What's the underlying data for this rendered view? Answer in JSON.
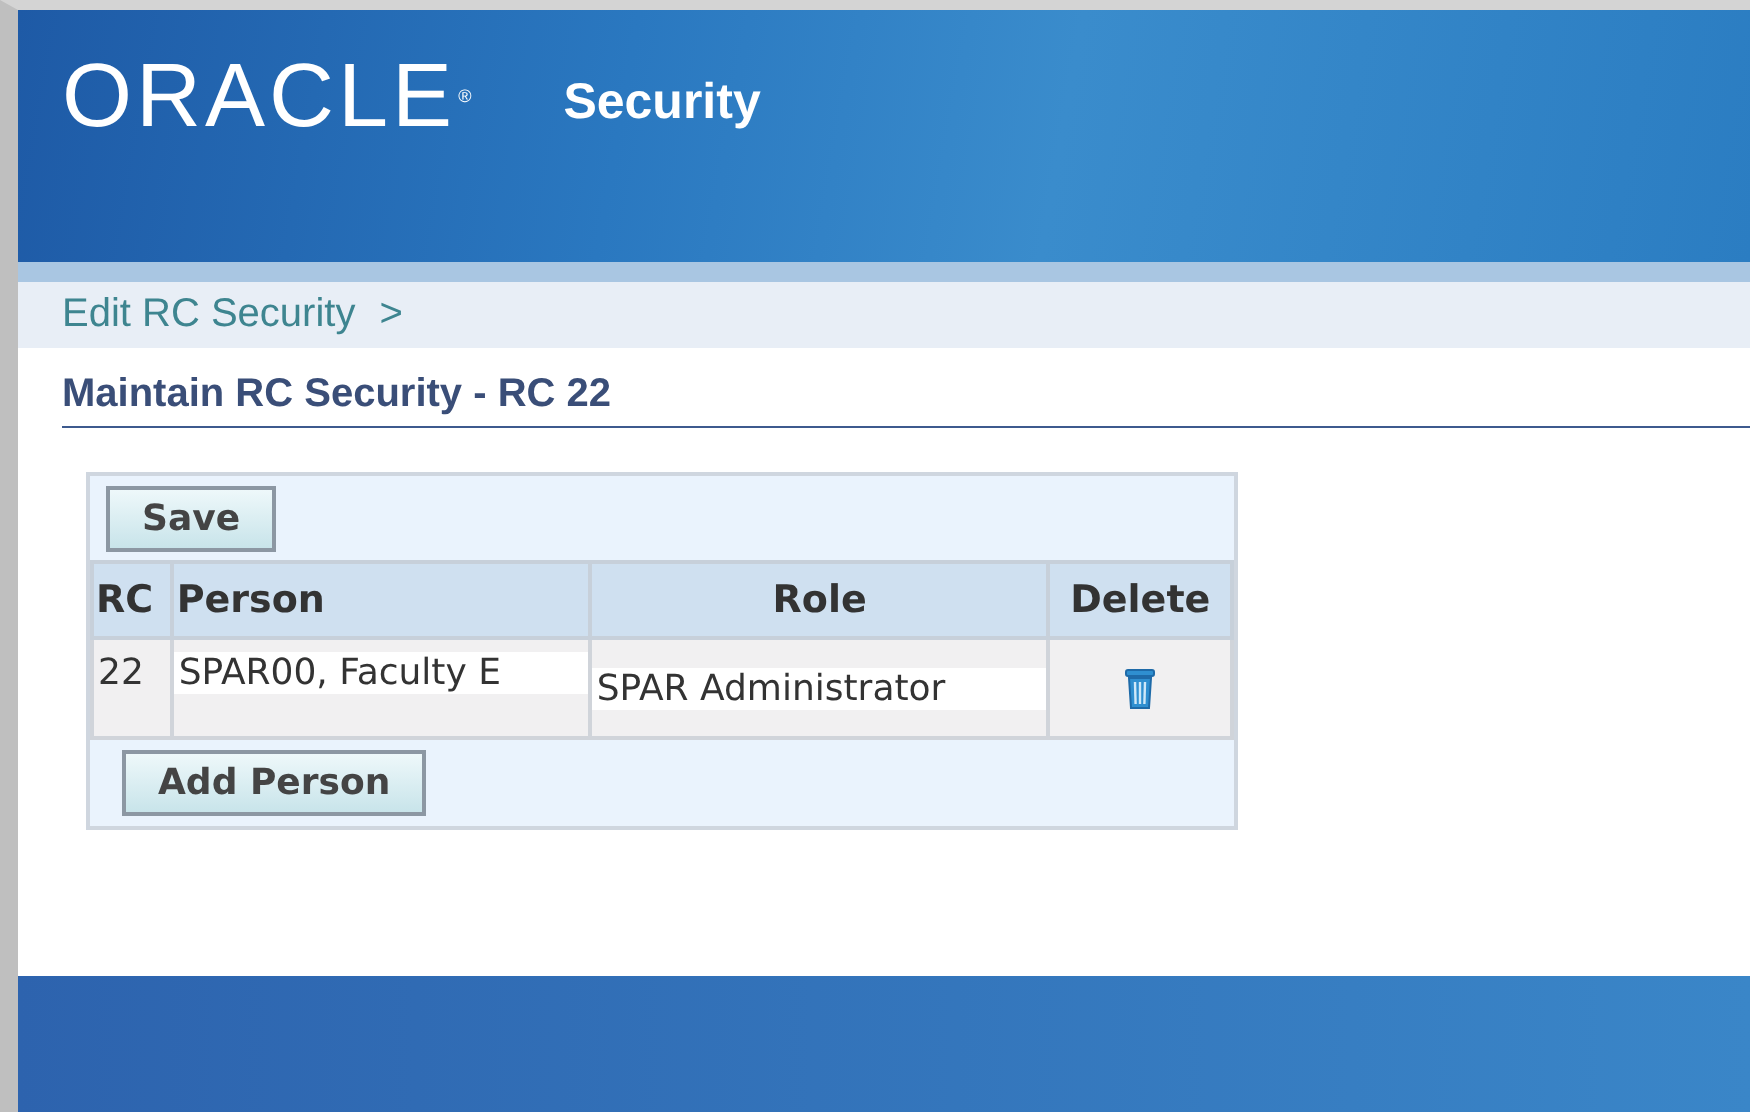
{
  "header": {
    "logo": "ORACLE",
    "logo_mark": "®",
    "title": "Security"
  },
  "breadcrumb": [
    {
      "label": "Edit RC Security",
      "separator": ">"
    }
  ],
  "page_title": "Maintain RC Security - RC 22",
  "save_button": "Save",
  "table": {
    "columns": [
      "RC",
      "Person",
      "Role",
      "Delete"
    ],
    "rows": [
      {
        "rc": "22",
        "person": "SPAR00, Faculty E",
        "role": "SPAR Administrator"
      }
    ]
  },
  "add_button": "Add Person"
}
